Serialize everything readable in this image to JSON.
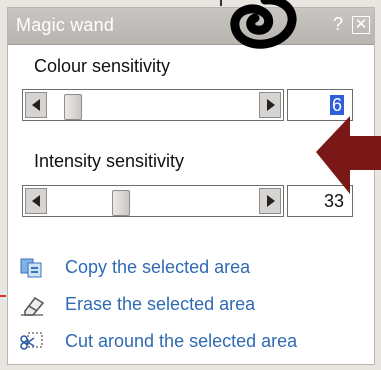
{
  "window": {
    "title": "Magic wand",
    "help_glyph": "?",
    "close_glyph": "✕"
  },
  "colour": {
    "label": "Colour sensitivity",
    "value": "6",
    "slider_level": 0.08
  },
  "intensity": {
    "label": "Intensity sensitivity",
    "value": "33",
    "slider_level": 0.33
  },
  "actions": [
    {
      "icon": "copy-area-icon",
      "label": "Copy the selected area"
    },
    {
      "icon": "eraser-icon",
      "label": "Erase the selected area"
    },
    {
      "icon": "scissors-select-icon",
      "label": "Cut around the selected area"
    }
  ],
  "colors": {
    "link": "#2f6ab3",
    "titlebar": "#bcb9b5",
    "selection": "#2c5fd8",
    "arrow_overlay": "#7a1717"
  }
}
